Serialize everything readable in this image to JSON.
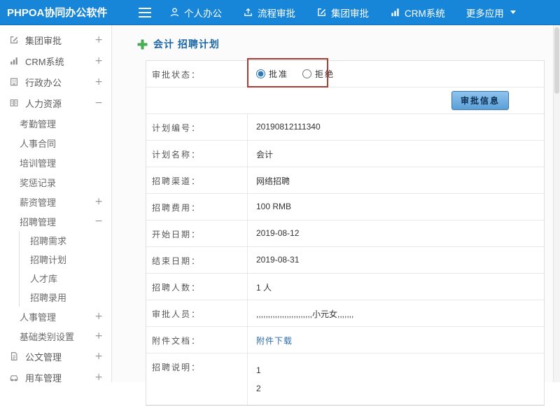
{
  "topbar": {
    "brand": "PHPOA协同办公软件",
    "items": [
      {
        "label": "个人办公",
        "icon": "user-icon"
      },
      {
        "label": "流程审批",
        "icon": "workflow-icon"
      },
      {
        "label": "集团审批",
        "icon": "edit-icon"
      },
      {
        "label": "CRM系统",
        "icon": "chart-icon"
      },
      {
        "label": "更多应用",
        "icon": "caret-down-icon"
      }
    ]
  },
  "sidebar": {
    "items": [
      {
        "label": "集团审批",
        "icon": "edit-icon",
        "expander": "+",
        "level": 0
      },
      {
        "label": "CRM系统",
        "icon": "chart-icon",
        "expander": "+",
        "level": 0
      },
      {
        "label": "行政办公",
        "icon": "office-icon",
        "expander": "+",
        "level": 0
      },
      {
        "label": "人力资源",
        "icon": "hr-icon",
        "expander": "−",
        "level": 0
      },
      {
        "label": "考勤管理",
        "level": 1
      },
      {
        "label": "人事合同",
        "level": 1
      },
      {
        "label": "培训管理",
        "level": 1
      },
      {
        "label": "奖惩记录",
        "level": 1
      },
      {
        "label": "薪资管理",
        "expander": "+",
        "level": 1
      },
      {
        "label": "招聘管理",
        "expander": "−",
        "level": 1
      },
      {
        "label": "招聘需求",
        "level": 2
      },
      {
        "label": "招聘计划",
        "level": 2
      },
      {
        "label": "人才库",
        "level": 2
      },
      {
        "label": "招聘录用",
        "level": 2
      },
      {
        "label": "人事管理",
        "expander": "+",
        "level": 1
      },
      {
        "label": "基础类别设置",
        "expander": "+",
        "level": 1
      },
      {
        "label": "公文管理",
        "icon": "doc-icon",
        "expander": "+",
        "level": 0
      },
      {
        "label": "用车管理",
        "icon": "car-icon",
        "expander": "+",
        "level": 0
      }
    ]
  },
  "main": {
    "page_title": "会计 招聘计划",
    "title_icon": "plus-icon",
    "approval": {
      "label": "审批状态：",
      "options": [
        {
          "label": "批准",
          "selected": true
        },
        {
          "label": "拒绝",
          "selected": false
        }
      ]
    },
    "approve_button_label": "审批信息",
    "fields": [
      {
        "label": "计划编号：",
        "value": "20190812111340"
      },
      {
        "label": "计划名称：",
        "value": "会计"
      },
      {
        "label": "招聘渠道：",
        "value": "网络招聘"
      },
      {
        "label": "招聘费用：",
        "value": "100 RMB"
      },
      {
        "label": "开始日期：",
        "value": "2019-08-12"
      },
      {
        "label": "结束日期：",
        "value": "2019-08-31"
      },
      {
        "label": "招聘人数：",
        "value": "1 人"
      },
      {
        "label": "审批人员：",
        "value": ",,,,,,,,,,,,,,,,,,,,,,,,小元女,,,,,,,"
      },
      {
        "label": "附件文档：",
        "value": "附件下载"
      },
      {
        "label": "招聘说明：",
        "value": "1\n2"
      }
    ]
  },
  "colors": {
    "topbar_blue": "#1786d9",
    "title_blue": "#1d67a7",
    "link_blue": "#2e6da8",
    "annotation_red": "#b03a2e",
    "plus_green": "#46b450",
    "button_blue": "#5aa0d8"
  }
}
